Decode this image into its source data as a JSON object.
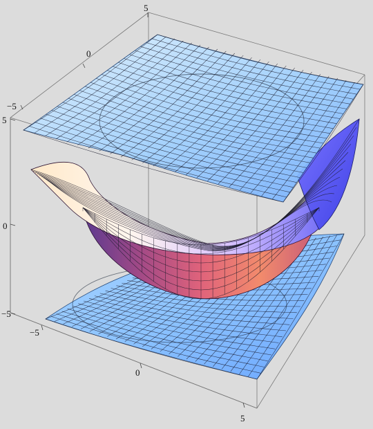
{
  "axes": {
    "x_ticks": [
      "−5",
      "0",
      "5"
    ],
    "y_ticks": [
      "−5",
      "0",
      "5"
    ],
    "z_ticks": [
      "−5",
      "0",
      "5"
    ],
    "top_ticks": [
      "5",
      "0",
      "−5"
    ]
  },
  "colors": {
    "background": "#dcdcdc",
    "plane_light": "#cfe9ff",
    "plane_dark": "#7db7ff",
    "bowl_warm": "#f2a277",
    "bowl_magenta": "#b24a8a",
    "bowl_blue": "#5a5cf0"
  }
}
